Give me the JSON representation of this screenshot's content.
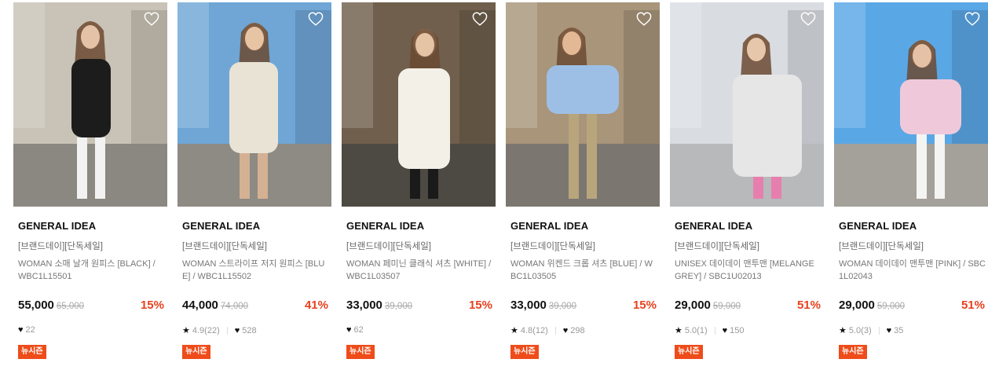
{
  "products": [
    {
      "brand": "GENERAL IDEA",
      "tag": "[브랜드데이][단독세일]",
      "name": "WOMAN 소매 날개 원피스 [BLACK] / WBC1L15501",
      "price": "55,000",
      "original_price": "65,000",
      "discount": "15%",
      "rating": "",
      "likes": "22",
      "badge": "뉴시즌",
      "heart_icon": "heart-outline-icon",
      "colors": {
        "sky": "#c9c2b6",
        "ground": "#8b8781",
        "garment": "#1c1c1c",
        "skin": "#e4c2a8"
      }
    },
    {
      "brand": "GENERAL IDEA",
      "tag": "[브랜드데이][단독세일]",
      "name": "WOMAN 스트라이프 저지 원피스 [BLUE] / WBC1L15502",
      "price": "44,000",
      "original_price": "74,000",
      "discount": "41%",
      "rating": "4.9(22)",
      "likes": "528",
      "badge": "뉴시즌",
      "heart_icon": "heart-outline-icon",
      "colors": {
        "sky": "#6fa6d6",
        "ground": "#8e8a84",
        "garment": "#e9e3d6",
        "skin": "#e7c4a4"
      }
    },
    {
      "brand": "GENERAL IDEA",
      "tag": "[브랜드데이][단독세일]",
      "name": "WOMAN 페미닌 클래식 셔츠 [WHITE] / WBC1L03507",
      "price": "33,000",
      "original_price": "39,000",
      "discount": "15%",
      "rating": "",
      "likes": "62",
      "badge": "뉴시즌",
      "heart_icon": "heart-outline-icon",
      "colors": {
        "sky": "#6f5f4c",
        "ground": "#4d4943",
        "garment": "#f3f0e8",
        "skin": "#e5c3a5"
      }
    },
    {
      "brand": "GENERAL IDEA",
      "tag": "[브랜드데이][단독세일]",
      "name": "WOMAN 위켄드 크롭 셔츠 [BLUE] / WBC1L03505",
      "price": "33,000",
      "original_price": "39,000",
      "discount": "15%",
      "rating": "4.8(12)",
      "likes": "298",
      "badge": "뉴시즌",
      "heart_icon": "heart-outline-icon",
      "colors": {
        "sky": "#a8957a",
        "ground": "#7c7670",
        "garment": "#9dbfe6",
        "skin": "#e3b894"
      }
    },
    {
      "brand": "GENERAL IDEA",
      "tag": "[브랜드데이][단독세일]",
      "name": "UNISEX 데이데이 맨투맨 [MELANGE GREY] / SBC1U02013",
      "price": "29,000",
      "original_price": "59,000",
      "discount": "51%",
      "rating": "5.0(1)",
      "likes": "150",
      "badge": "뉴시즌",
      "heart_icon": "heart-outline-icon",
      "colors": {
        "sky": "#d9dde2",
        "ground": "#b7b9bb",
        "garment": "#e6e6e6",
        "skin": "#e7c7ac"
      }
    },
    {
      "brand": "GENERAL IDEA",
      "tag": "[브랜드데이][단독세일]",
      "name": "WOMAN 데이데이 맨투맨 [PINK] / SBC1L02043",
      "price": "29,000",
      "original_price": "59,000",
      "discount": "51%",
      "rating": "5.0(3)",
      "likes": "35",
      "badge": "뉴시즌",
      "heart_icon": "heart-outline-icon",
      "colors": {
        "sky": "#5aa7e6",
        "ground": "#a4a09a",
        "garment": "#efc9da",
        "skin": "#e5c2a6"
      }
    }
  ]
}
